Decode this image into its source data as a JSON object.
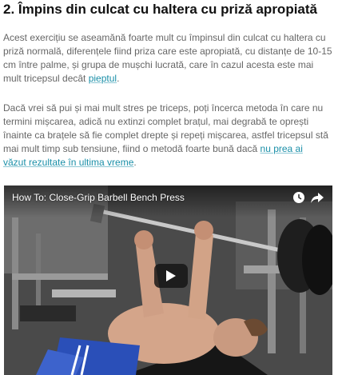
{
  "article": {
    "heading": "2. Împins din culcat cu haltera cu priză apropiată",
    "paragraph1": {
      "line1": "Acest exercițiu se aseamănă foarte mult cu împinsul din culcat cu haltera cu",
      "line2": "priză normală, diferențele fiind priza care este apropiată, cu distanțe de 10-15",
      "line3": "cm între palme, și grupa de mușchi lucrată, care în cazul acesta este mai",
      "line4_text": "mult tricepsul decât ",
      "line4_link": "pieptul",
      "line4_end": "."
    },
    "paragraph2": {
      "line1": "Dacă vrei să pui și mai mult stres pe triceps, poți încerca metoda în care nu",
      "line2": "termini mișcarea, adică nu extinzi complet brațul, mai degrabă te oprești",
      "line3": "înainte ca brațele să fie complet drepte și repeți mișcarea, astfel tricepsul stă",
      "line4_text": "mai mult timp sub tensiune, fiind o metodă foarte bună dacă ",
      "line4_link": "nu prea ai",
      "line5_link": "văzut rezultate în ultima vreme",
      "line5_end": "."
    }
  },
  "video": {
    "title": "How To: Close-Grip Barbell Bench Press",
    "icons": {
      "watch_later": "clock-icon",
      "share": "share-icon",
      "play": "play-icon"
    }
  },
  "colors": {
    "link": "#1a8fa8",
    "heading": "#111111",
    "body_text": "#666666"
  }
}
